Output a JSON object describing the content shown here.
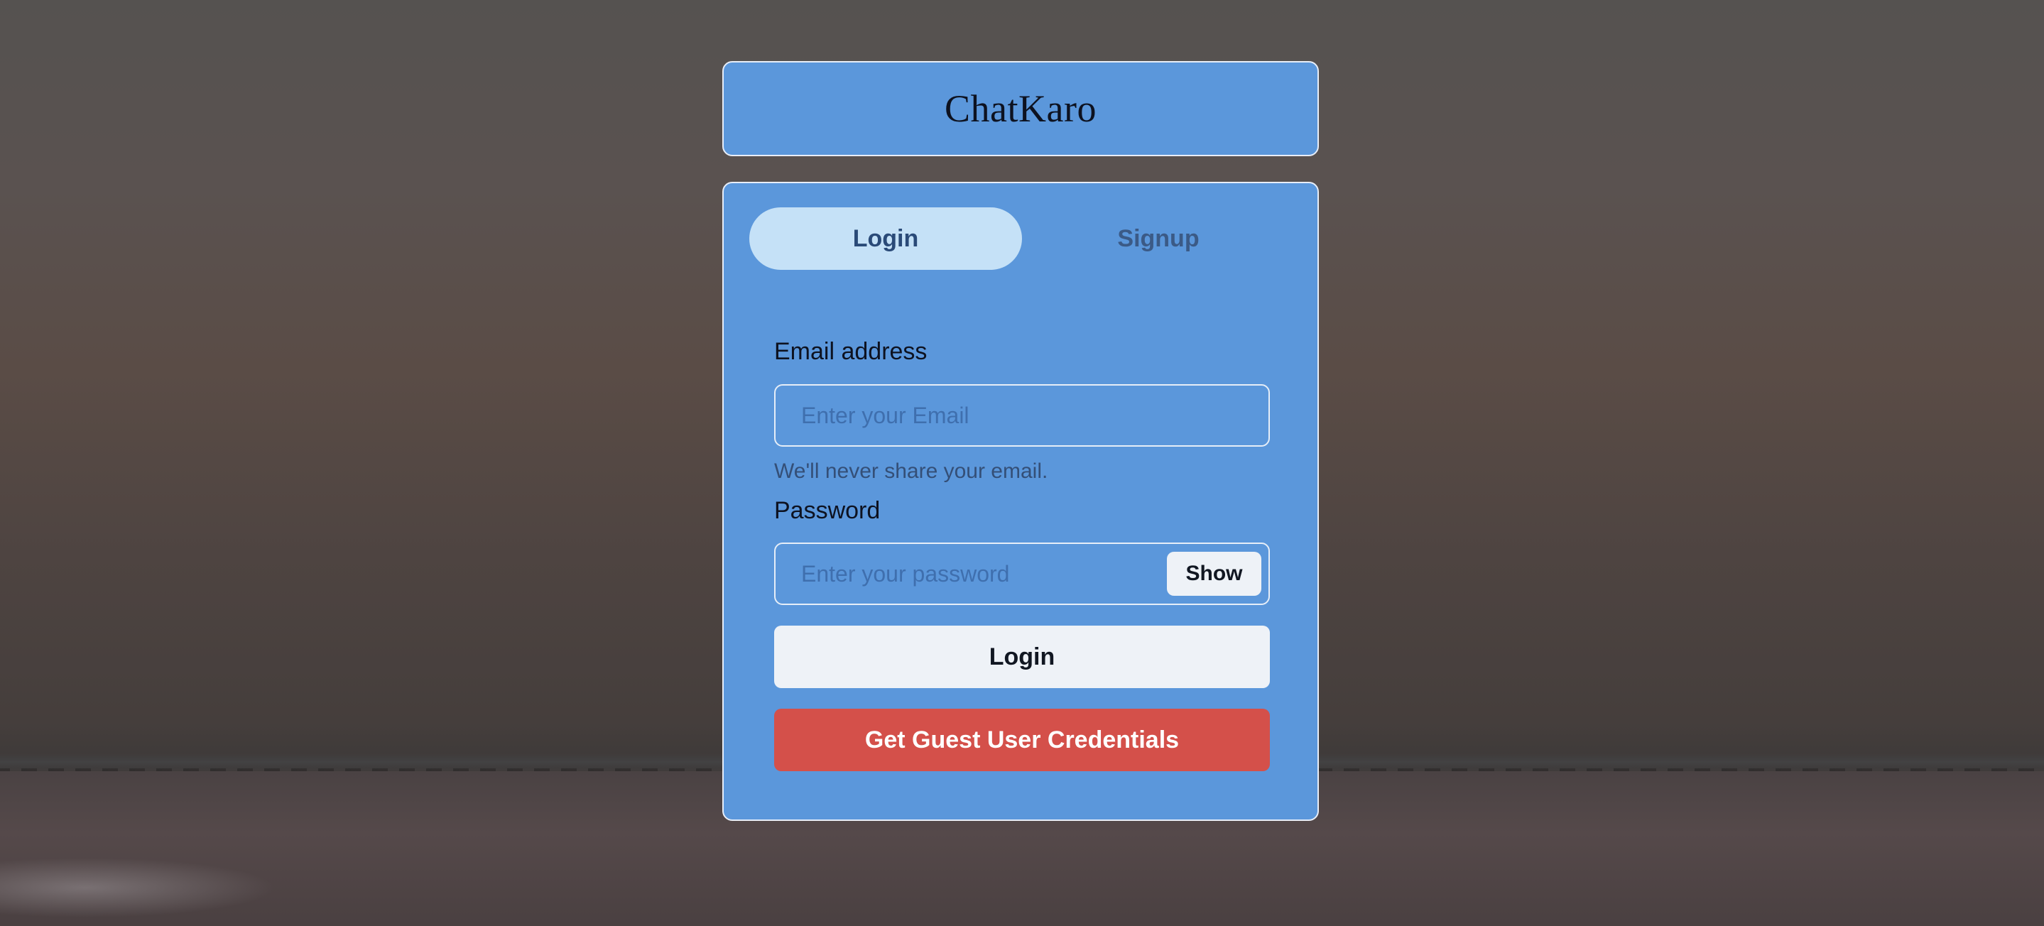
{
  "app": {
    "title": "ChatKaro"
  },
  "tabs": [
    {
      "label": "Login",
      "active": true
    },
    {
      "label": "Signup",
      "active": false
    }
  ],
  "email": {
    "label": "Email address",
    "placeholder": "Enter your Email",
    "value": "",
    "helper": "We'll never share your email."
  },
  "password": {
    "label": "Password",
    "placeholder": "Enter your password",
    "value": "",
    "toggle_label": "Show"
  },
  "actions": {
    "login_label": "Login",
    "guest_label": "Get Guest User Credentials"
  },
  "colors": {
    "card_bg": "#5b97db",
    "active_tab_bg": "#c5e1f7",
    "guest_button_bg": "#d4504a",
    "login_button_bg": "#eef2f7"
  }
}
